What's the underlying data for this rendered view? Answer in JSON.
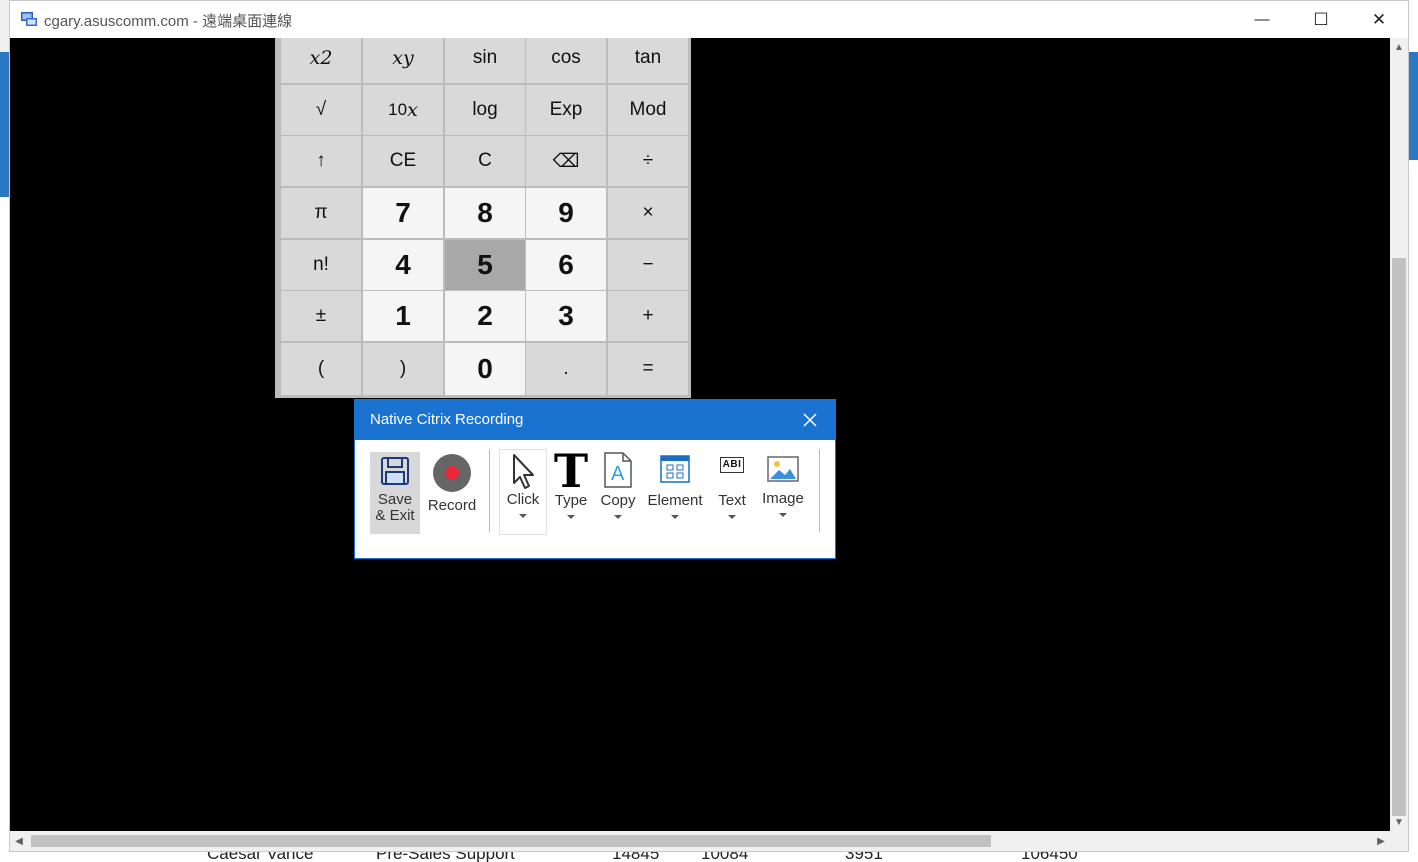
{
  "window": {
    "title": "cgary.asuscomm.com - 遠端桌面連線",
    "minimize_glyph": "—",
    "maximize_glyph": "☐",
    "close_glyph": "✕"
  },
  "background_row": {
    "name": "Caesar Vance",
    "department": "Pre-Sales Support",
    "col1": "14845",
    "col2": "10084",
    "col3": "3951",
    "col4": "106450"
  },
  "calculator": {
    "rows": [
      [
        {
          "id": "x2",
          "type": "fn"
        },
        {
          "id": "xy",
          "type": "fn"
        },
        {
          "label": "sin",
          "type": "fn"
        },
        {
          "label": "cos",
          "type": "fn"
        },
        {
          "label": "tan",
          "type": "fn"
        }
      ],
      [
        {
          "label": "√",
          "type": "fn"
        },
        {
          "id": "10x",
          "type": "fn"
        },
        {
          "label": "log",
          "type": "fn"
        },
        {
          "label": "Exp",
          "type": "fn"
        },
        {
          "label": "Mod",
          "type": "fn"
        }
      ],
      [
        {
          "label": "↑",
          "type": "fn"
        },
        {
          "label": "CE",
          "type": "fn"
        },
        {
          "label": "C",
          "type": "fn"
        },
        {
          "label": "⌫",
          "type": "fn"
        },
        {
          "label": "÷",
          "type": "fn"
        }
      ],
      [
        {
          "label": "π",
          "type": "fn"
        },
        {
          "label": "7",
          "type": "num"
        },
        {
          "label": "8",
          "type": "num"
        },
        {
          "label": "9",
          "type": "num"
        },
        {
          "label": "×",
          "type": "fn"
        }
      ],
      [
        {
          "label": "n!",
          "type": "fn"
        },
        {
          "label": "4",
          "type": "num"
        },
        {
          "label": "5",
          "type": "num",
          "pressed": true
        },
        {
          "label": "6",
          "type": "num"
        },
        {
          "label": "−",
          "type": "fn"
        }
      ],
      [
        {
          "label": "±",
          "type": "fn"
        },
        {
          "label": "1",
          "type": "num"
        },
        {
          "label": "2",
          "type": "num"
        },
        {
          "label": "3",
          "type": "num"
        },
        {
          "label": "+",
          "type": "fn"
        }
      ],
      [
        {
          "label": "(",
          "type": "fn"
        },
        {
          "label": ")",
          "type": "fn"
        },
        {
          "label": "0",
          "type": "num"
        },
        {
          "label": ".",
          "type": "fn"
        },
        {
          "label": "=",
          "type": "fn"
        }
      ]
    ],
    "x2": {
      "base": "x",
      "sup": "2"
    },
    "xy": {
      "base": "x",
      "sup": "y"
    },
    "10x": {
      "base": "10",
      "sup": "x"
    }
  },
  "recording": {
    "title": "Native Citrix Recording",
    "save_line1": "Save",
    "save_line2": "& Exit",
    "record_label": "Record",
    "click_label": "Click",
    "type_label": "Type",
    "copy_label": "Copy",
    "element_label": "Element",
    "text_label": "Text",
    "image_label": "Image",
    "text_icon_glyph": "T",
    "copy_icon_glyph": "A",
    "text_tool_icon_glyph": "ABI",
    "record_color": "#e8293a",
    "accent": "#1a73d1"
  }
}
